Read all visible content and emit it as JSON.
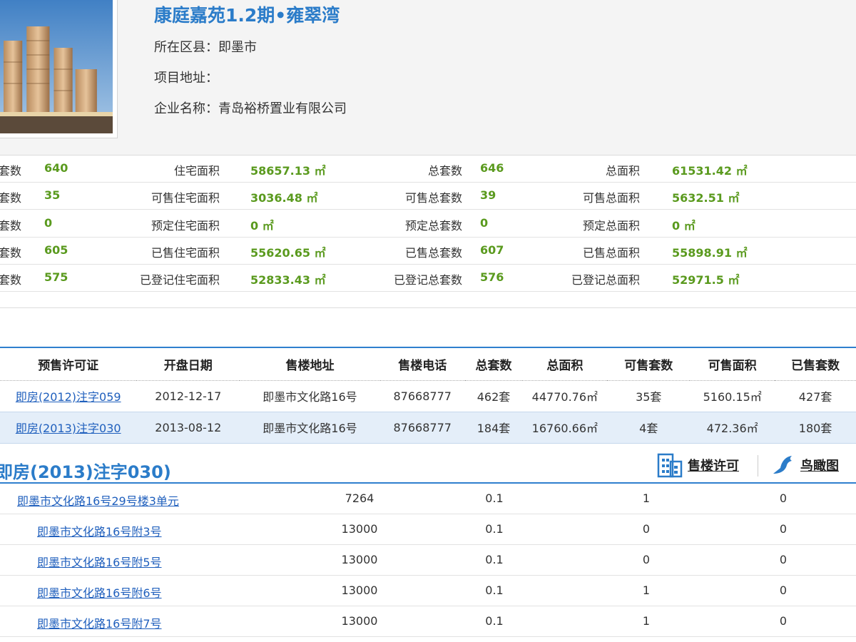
{
  "project": {
    "title": "康庭嘉苑1.2期•雍翠湾",
    "district": "所在区县：即墨市",
    "address": "项目地址：",
    "company": "企业名称：青岛裕桥置业有限公司"
  },
  "stats": {
    "rows": [
      {
        "a_label": "套数",
        "a_value": "640",
        "b_label": "住宅面积",
        "b_value": "58657.13 ㎡",
        "c_label": "总套数",
        "c_value": "646",
        "d_label": "总面积",
        "d_value": "61531.42 ㎡"
      },
      {
        "a_label": "套数",
        "a_value": "35",
        "b_label": "可售住宅面积",
        "b_value": "3036.48 ㎡",
        "c_label": "可售总套数",
        "c_value": "39",
        "d_label": "可售总面积",
        "d_value": "5632.51 ㎡"
      },
      {
        "a_label": "套数",
        "a_value": "0",
        "b_label": "预定住宅面积",
        "b_value": "0 ㎡",
        "c_label": "预定总套数",
        "c_value": "0",
        "d_label": "预定总面积",
        "d_value": "0 ㎡"
      },
      {
        "a_label": "套数",
        "a_value": "605",
        "b_label": "已售住宅面积",
        "b_value": "55620.65 ㎡",
        "c_label": "已售总套数",
        "c_value": "607",
        "d_label": "已售总面积",
        "d_value": "55898.91 ㎡"
      },
      {
        "a_label": "套数",
        "a_value": "575",
        "b_label": "已登记住宅面积",
        "b_value": "52833.43 ㎡",
        "c_label": "已登记总套数",
        "c_value": "576",
        "d_label": "已登记总面积",
        "d_value": "52971.5 ㎡"
      }
    ]
  },
  "permits": {
    "headers": [
      "预售许可证",
      "开盘日期",
      "售楼地址",
      "售楼电话",
      "总套数",
      "总面积",
      "可售套数",
      "可售面积",
      "已售套数"
    ],
    "rows": [
      {
        "permit": "即房(2012)注字059",
        "date": "2012-12-17",
        "addr": "即墨市文化路16号",
        "phone": "87668777",
        "total": "462套",
        "area": "44770.76㎡",
        "avail": "35套",
        "avail_area": "5160.15㎡",
        "sold": "427套"
      },
      {
        "permit": "即房(2013)注字030",
        "date": "2013-08-12",
        "addr": "即墨市文化路16号",
        "phone": "87668777",
        "total": "184套",
        "area": "16760.66㎡",
        "avail": "4套",
        "avail_area": "472.36㎡",
        "sold": "180套"
      }
    ]
  },
  "section": {
    "title": "即房(2013)注字030)",
    "permit_link": "售楼许可",
    "aerial_link": "鸟瞰图"
  },
  "buildings": [
    {
      "name": "即墨市文化路16号29号楼3单元",
      "v1": "7264",
      "v2": "0.1",
      "v3": "1",
      "v4": "0"
    },
    {
      "name": "即墨市文化路16号附3号",
      "v1": "13000",
      "v2": "0.1",
      "v3": "0",
      "v4": "0"
    },
    {
      "name": "即墨市文化路16号附5号",
      "v1": "13000",
      "v2": "0.1",
      "v3": "0",
      "v4": "0"
    },
    {
      "name": "即墨市文化路16号附6号",
      "v1": "13000",
      "v2": "0.1",
      "v3": "1",
      "v4": "0"
    },
    {
      "name": "即墨市文化路16号附7号",
      "v1": "13000",
      "v2": "0.1",
      "v3": "1",
      "v4": "0"
    }
  ]
}
